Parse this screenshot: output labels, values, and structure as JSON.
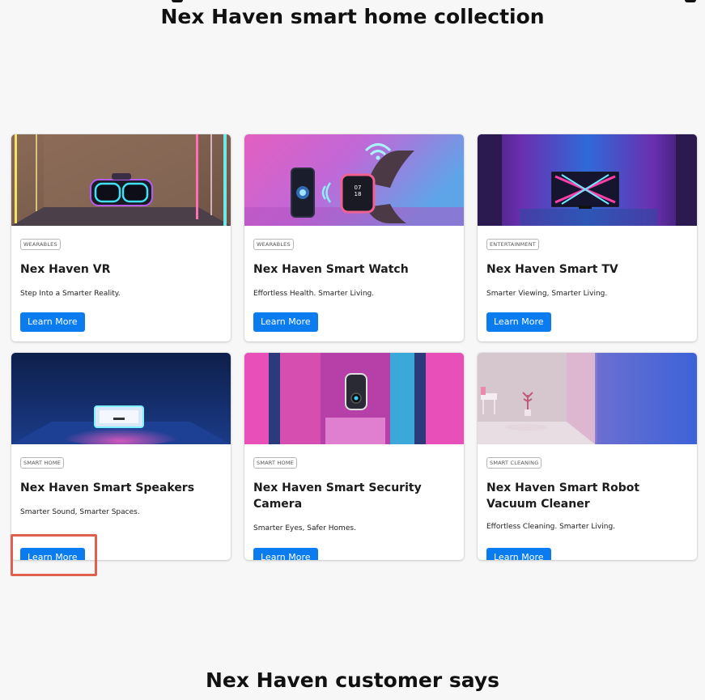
{
  "collection": {
    "title": "Nex Haven smart home collection"
  },
  "testimonials": {
    "title": "Nex Haven customer says"
  },
  "cards": [
    {
      "category": "WEARABLES",
      "title": "Nex Haven VR",
      "description": "Step Into a Smarter Reality.",
      "button": "Learn More",
      "image": "vr-headset-image"
    },
    {
      "category": "WEARABLES",
      "title": "Nex Haven Smart Watch",
      "description": "Effortless Health. Smarter Living.",
      "button": "Learn More",
      "image": "smart-watch-image"
    },
    {
      "category": "ENTERTAINMENT",
      "title": "Nex Haven Smart TV",
      "description": "Smarter Viewing, Smarter Living.",
      "button": "Learn More",
      "image": "smart-tv-image"
    },
    {
      "category": "SMART HOME",
      "title": "Nex Haven Smart Speakers",
      "description": "Smarter Sound, Smarter Spaces.",
      "button": "Learn More",
      "image": "smart-speaker-image"
    },
    {
      "category": "SMART HOME",
      "title": "Nex Haven Smart Security Camera",
      "description": "Smarter Eyes, Safer Homes.",
      "button": "Learn More",
      "image": "security-camera-image"
    },
    {
      "category": "SMART CLEANING",
      "title": "Nex Haven Smart Robot Vacuum Cleaner",
      "description": "Effortless Cleaning. Smarter Living.",
      "button": "Learn More",
      "image": "robot-vacuum-image"
    }
  ],
  "colors": {
    "button": "#0a7cf0",
    "highlight": "#e0604f",
    "background": "#f7f7f8"
  },
  "highlighted_button": "cards.3.button"
}
